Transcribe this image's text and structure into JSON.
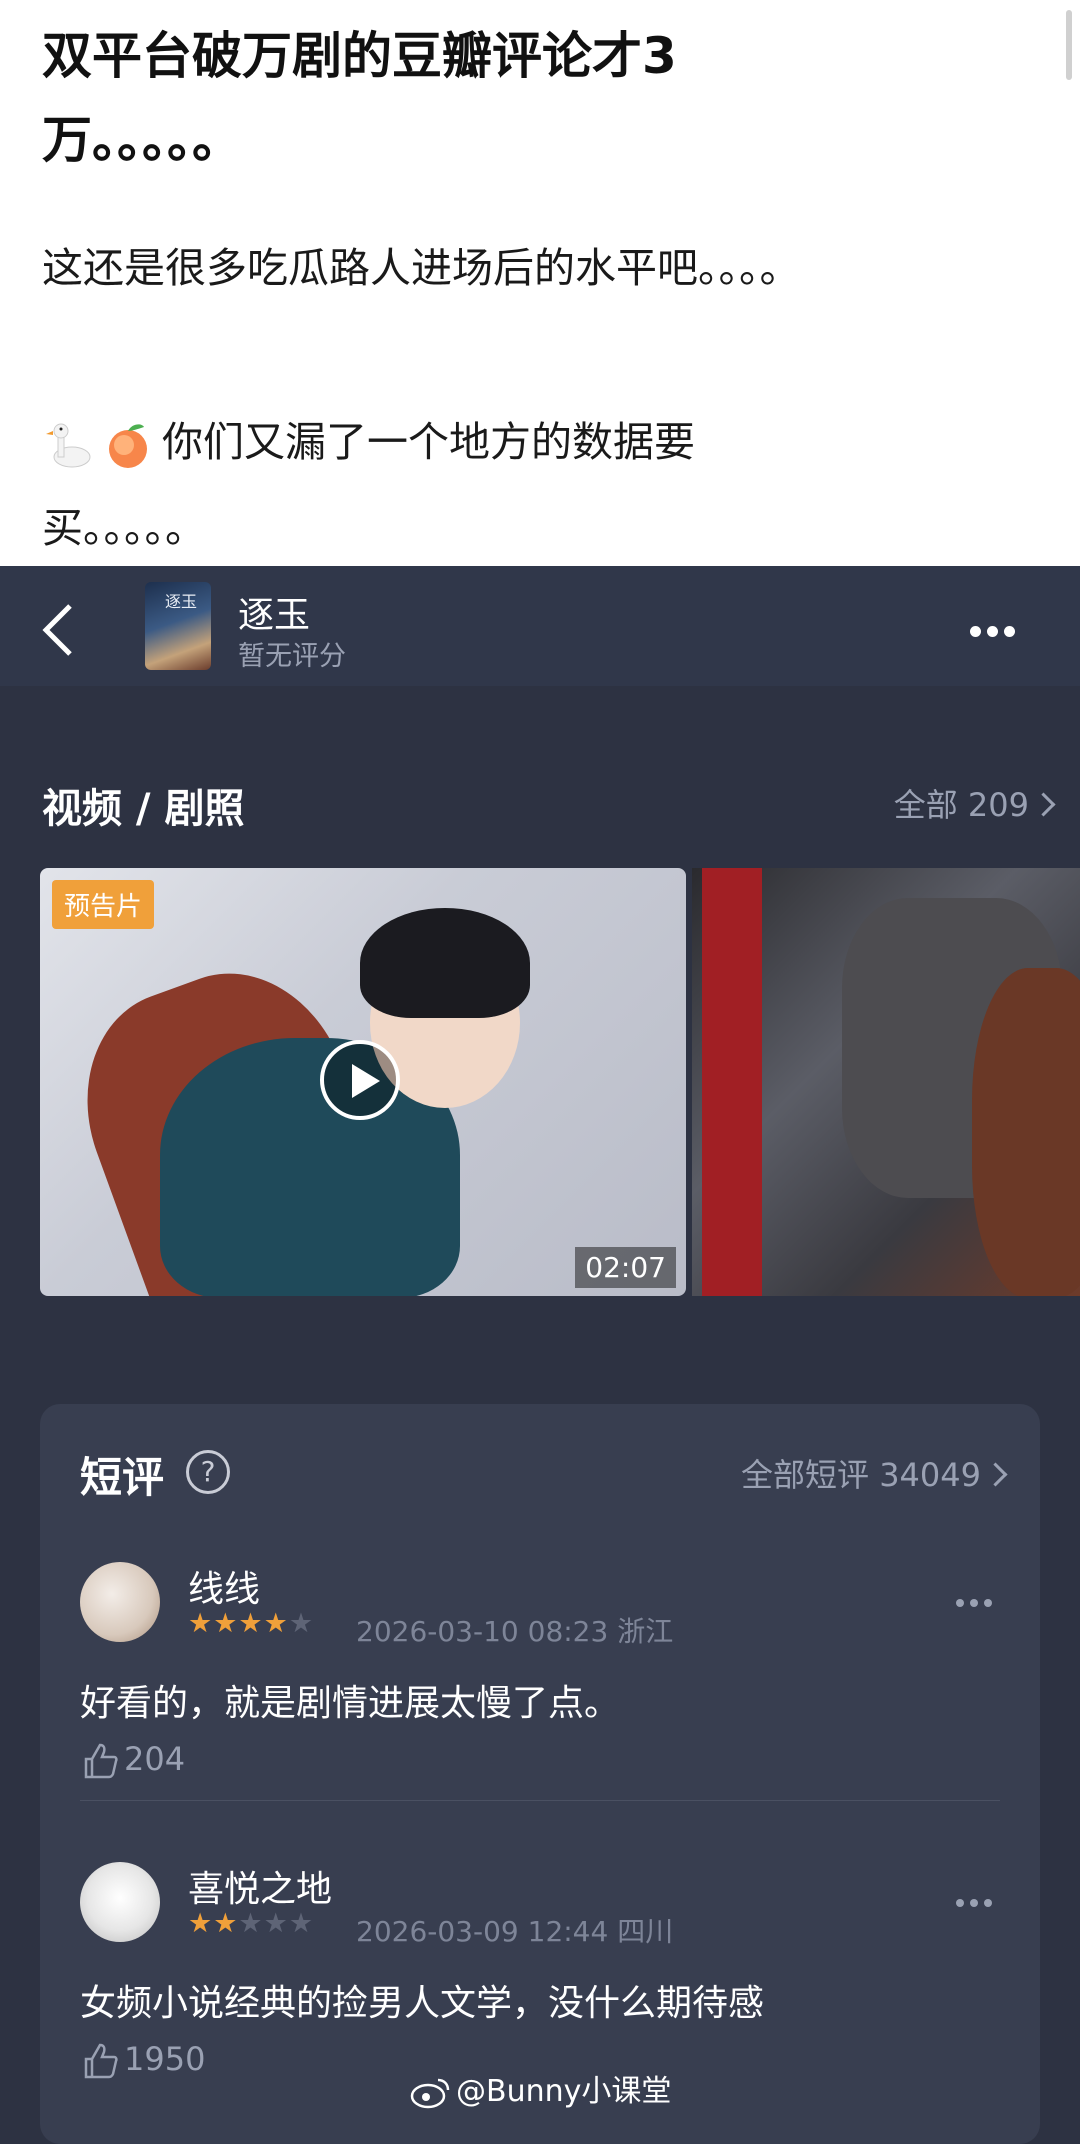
{
  "post": {
    "title": "双平台破万剧的豆瓣评论才3万。。。。。",
    "line1": "这还是很多吃瓜路人进场后的水平吧。。。。",
    "line2": "你们又漏了一个地方的数据要",
    "line3": "买。。。。。",
    "emojis": [
      "goose-icon",
      "peach-icon"
    ]
  },
  "app": {
    "header": {
      "title": "逐玉",
      "subtitle": "暂无评分",
      "poster_text": "逐玉"
    },
    "media_section": {
      "title": "视频 / 剧照",
      "all_label": "全部 209",
      "video": {
        "tag": "预告片",
        "duration": "02:07"
      }
    },
    "reviews_section": {
      "title": "短评",
      "help_symbol": "?",
      "all_label": "全部短评 34049",
      "reviews": [
        {
          "user": "线线",
          "rating": 4,
          "max_rating": 5,
          "meta": "2026-03-10 08:23 浙江",
          "text": "好看的，就是剧情进展太慢了点。",
          "likes": "204"
        },
        {
          "user": "喜悦之地",
          "rating": 2,
          "max_rating": 5,
          "meta": "2026-03-09 12:44 四川",
          "text": "女频小说经典的捡男人文学，没什么期待感",
          "likes": "1950"
        }
      ]
    },
    "watermark": "@Bunny小课堂"
  },
  "colors": {
    "accent": "#f0a03a",
    "bg": "#2d3242",
    "card": "#383e50",
    "header": "#30374a"
  }
}
